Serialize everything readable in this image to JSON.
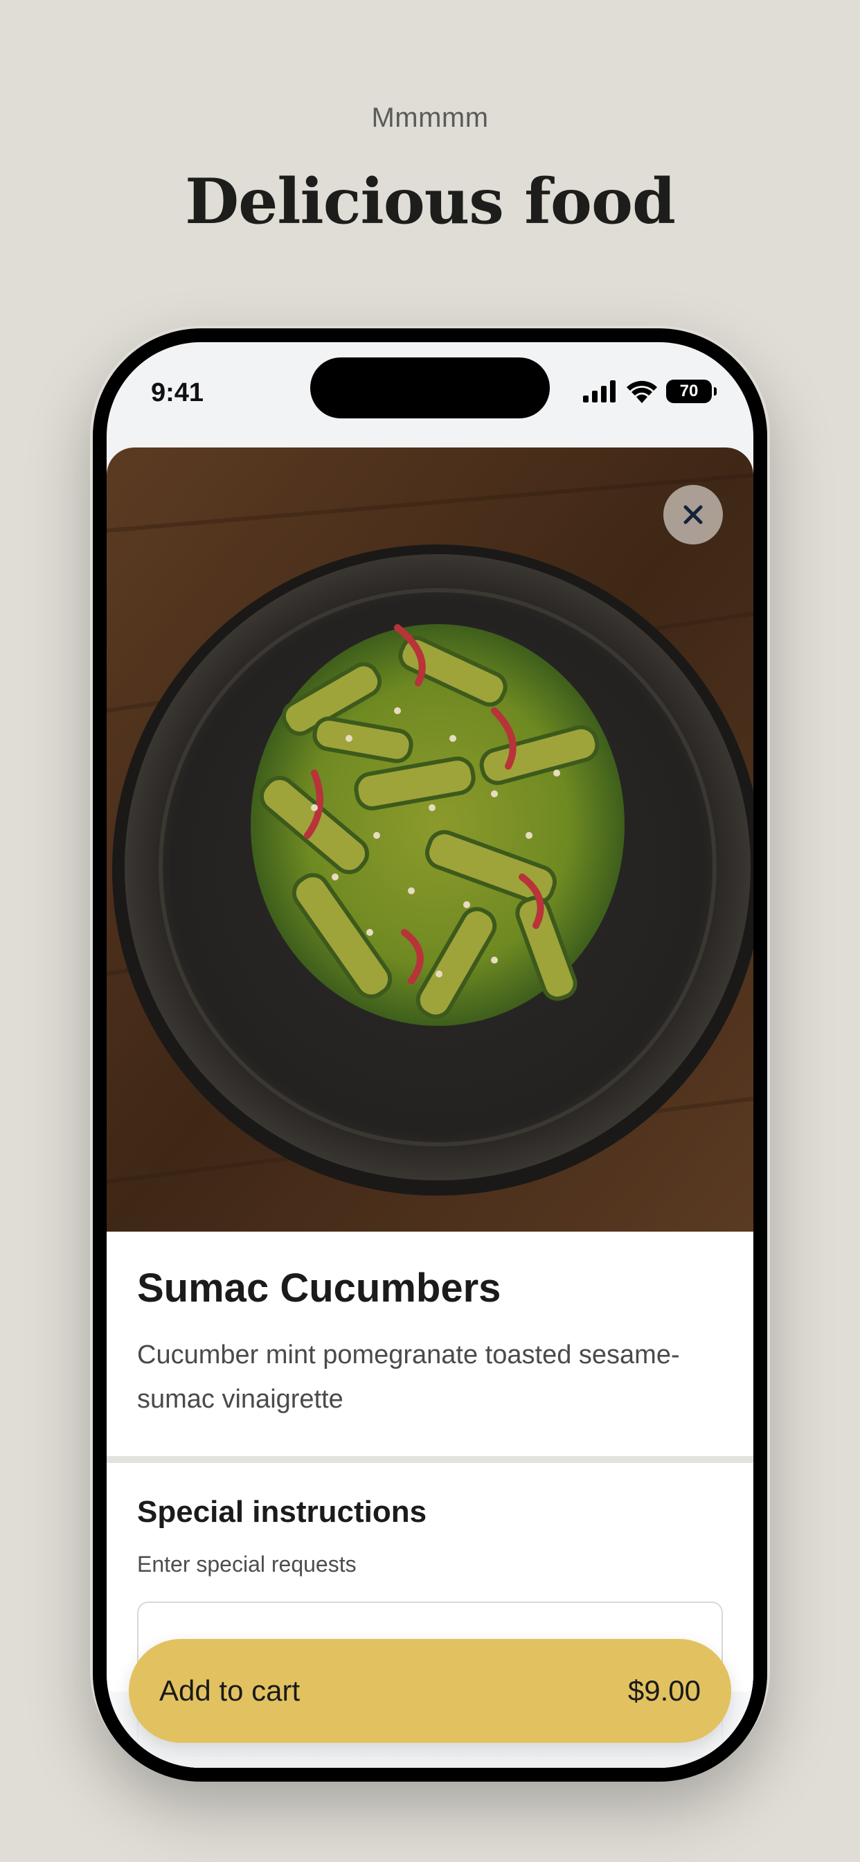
{
  "header": {
    "kicker": "Mmmmm",
    "title": "Delicious food"
  },
  "status_bar": {
    "time": "9:41",
    "battery": "70"
  },
  "item": {
    "name": "Sumac Cucumbers",
    "description": "Cucumber mint pomegranate toasted sesame-sumac vinaigrette"
  },
  "instructions": {
    "title": "Special instructions",
    "hint": "Enter special requests"
  },
  "cart_button": {
    "label": "Add to cart",
    "price": "$9.00"
  },
  "colors": {
    "background": "#e0ddd6",
    "accent": "#e2c260"
  },
  "icons": {
    "close": "close-icon",
    "signal": "signal-icon",
    "wifi": "wifi-icon",
    "battery": "battery-icon"
  }
}
